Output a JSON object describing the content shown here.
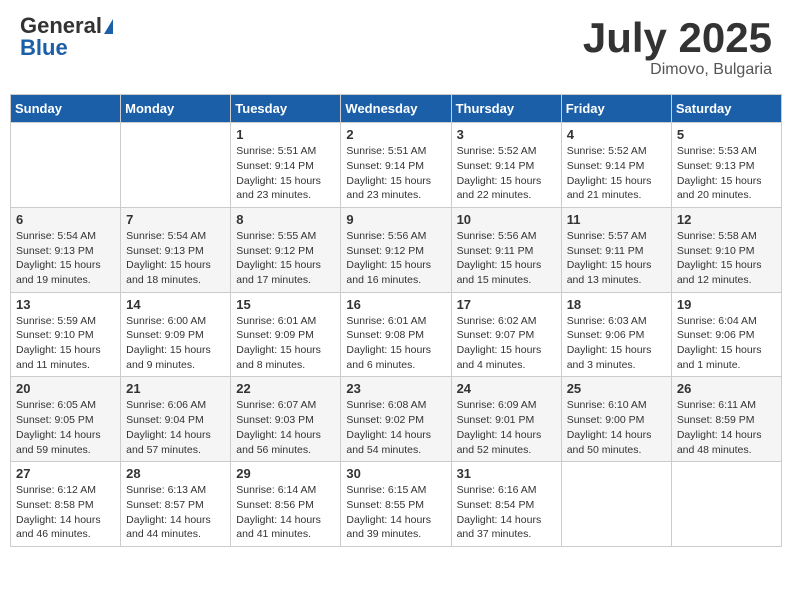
{
  "header": {
    "logo_general": "General",
    "logo_blue": "Blue",
    "title": "July 2025",
    "location": "Dimovo, Bulgaria"
  },
  "days_of_week": [
    "Sunday",
    "Monday",
    "Tuesday",
    "Wednesday",
    "Thursday",
    "Friday",
    "Saturday"
  ],
  "weeks": [
    [
      {
        "day": "",
        "sunrise": "",
        "sunset": "",
        "daylight": ""
      },
      {
        "day": "",
        "sunrise": "",
        "sunset": "",
        "daylight": ""
      },
      {
        "day": "1",
        "sunrise": "Sunrise: 5:51 AM",
        "sunset": "Sunset: 9:14 PM",
        "daylight": "Daylight: 15 hours and 23 minutes."
      },
      {
        "day": "2",
        "sunrise": "Sunrise: 5:51 AM",
        "sunset": "Sunset: 9:14 PM",
        "daylight": "Daylight: 15 hours and 23 minutes."
      },
      {
        "day": "3",
        "sunrise": "Sunrise: 5:52 AM",
        "sunset": "Sunset: 9:14 PM",
        "daylight": "Daylight: 15 hours and 22 minutes."
      },
      {
        "day": "4",
        "sunrise": "Sunrise: 5:52 AM",
        "sunset": "Sunset: 9:14 PM",
        "daylight": "Daylight: 15 hours and 21 minutes."
      },
      {
        "day": "5",
        "sunrise": "Sunrise: 5:53 AM",
        "sunset": "Sunset: 9:13 PM",
        "daylight": "Daylight: 15 hours and 20 minutes."
      }
    ],
    [
      {
        "day": "6",
        "sunrise": "Sunrise: 5:54 AM",
        "sunset": "Sunset: 9:13 PM",
        "daylight": "Daylight: 15 hours and 19 minutes."
      },
      {
        "day": "7",
        "sunrise": "Sunrise: 5:54 AM",
        "sunset": "Sunset: 9:13 PM",
        "daylight": "Daylight: 15 hours and 18 minutes."
      },
      {
        "day": "8",
        "sunrise": "Sunrise: 5:55 AM",
        "sunset": "Sunset: 9:12 PM",
        "daylight": "Daylight: 15 hours and 17 minutes."
      },
      {
        "day": "9",
        "sunrise": "Sunrise: 5:56 AM",
        "sunset": "Sunset: 9:12 PM",
        "daylight": "Daylight: 15 hours and 16 minutes."
      },
      {
        "day": "10",
        "sunrise": "Sunrise: 5:56 AM",
        "sunset": "Sunset: 9:11 PM",
        "daylight": "Daylight: 15 hours and 15 minutes."
      },
      {
        "day": "11",
        "sunrise": "Sunrise: 5:57 AM",
        "sunset": "Sunset: 9:11 PM",
        "daylight": "Daylight: 15 hours and 13 minutes."
      },
      {
        "day": "12",
        "sunrise": "Sunrise: 5:58 AM",
        "sunset": "Sunset: 9:10 PM",
        "daylight": "Daylight: 15 hours and 12 minutes."
      }
    ],
    [
      {
        "day": "13",
        "sunrise": "Sunrise: 5:59 AM",
        "sunset": "Sunset: 9:10 PM",
        "daylight": "Daylight: 15 hours and 11 minutes."
      },
      {
        "day": "14",
        "sunrise": "Sunrise: 6:00 AM",
        "sunset": "Sunset: 9:09 PM",
        "daylight": "Daylight: 15 hours and 9 minutes."
      },
      {
        "day": "15",
        "sunrise": "Sunrise: 6:01 AM",
        "sunset": "Sunset: 9:09 PM",
        "daylight": "Daylight: 15 hours and 8 minutes."
      },
      {
        "day": "16",
        "sunrise": "Sunrise: 6:01 AM",
        "sunset": "Sunset: 9:08 PM",
        "daylight": "Daylight: 15 hours and 6 minutes."
      },
      {
        "day": "17",
        "sunrise": "Sunrise: 6:02 AM",
        "sunset": "Sunset: 9:07 PM",
        "daylight": "Daylight: 15 hours and 4 minutes."
      },
      {
        "day": "18",
        "sunrise": "Sunrise: 6:03 AM",
        "sunset": "Sunset: 9:06 PM",
        "daylight": "Daylight: 15 hours and 3 minutes."
      },
      {
        "day": "19",
        "sunrise": "Sunrise: 6:04 AM",
        "sunset": "Sunset: 9:06 PM",
        "daylight": "Daylight: 15 hours and 1 minute."
      }
    ],
    [
      {
        "day": "20",
        "sunrise": "Sunrise: 6:05 AM",
        "sunset": "Sunset: 9:05 PM",
        "daylight": "Daylight: 14 hours and 59 minutes."
      },
      {
        "day": "21",
        "sunrise": "Sunrise: 6:06 AM",
        "sunset": "Sunset: 9:04 PM",
        "daylight": "Daylight: 14 hours and 57 minutes."
      },
      {
        "day": "22",
        "sunrise": "Sunrise: 6:07 AM",
        "sunset": "Sunset: 9:03 PM",
        "daylight": "Daylight: 14 hours and 56 minutes."
      },
      {
        "day": "23",
        "sunrise": "Sunrise: 6:08 AM",
        "sunset": "Sunset: 9:02 PM",
        "daylight": "Daylight: 14 hours and 54 minutes."
      },
      {
        "day": "24",
        "sunrise": "Sunrise: 6:09 AM",
        "sunset": "Sunset: 9:01 PM",
        "daylight": "Daylight: 14 hours and 52 minutes."
      },
      {
        "day": "25",
        "sunrise": "Sunrise: 6:10 AM",
        "sunset": "Sunset: 9:00 PM",
        "daylight": "Daylight: 14 hours and 50 minutes."
      },
      {
        "day": "26",
        "sunrise": "Sunrise: 6:11 AM",
        "sunset": "Sunset: 8:59 PM",
        "daylight": "Daylight: 14 hours and 48 minutes."
      }
    ],
    [
      {
        "day": "27",
        "sunrise": "Sunrise: 6:12 AM",
        "sunset": "Sunset: 8:58 PM",
        "daylight": "Daylight: 14 hours and 46 minutes."
      },
      {
        "day": "28",
        "sunrise": "Sunrise: 6:13 AM",
        "sunset": "Sunset: 8:57 PM",
        "daylight": "Daylight: 14 hours and 44 minutes."
      },
      {
        "day": "29",
        "sunrise": "Sunrise: 6:14 AM",
        "sunset": "Sunset: 8:56 PM",
        "daylight": "Daylight: 14 hours and 41 minutes."
      },
      {
        "day": "30",
        "sunrise": "Sunrise: 6:15 AM",
        "sunset": "Sunset: 8:55 PM",
        "daylight": "Daylight: 14 hours and 39 minutes."
      },
      {
        "day": "31",
        "sunrise": "Sunrise: 6:16 AM",
        "sunset": "Sunset: 8:54 PM",
        "daylight": "Daylight: 14 hours and 37 minutes."
      },
      {
        "day": "",
        "sunrise": "",
        "sunset": "",
        "daylight": ""
      },
      {
        "day": "",
        "sunrise": "",
        "sunset": "",
        "daylight": ""
      }
    ]
  ]
}
